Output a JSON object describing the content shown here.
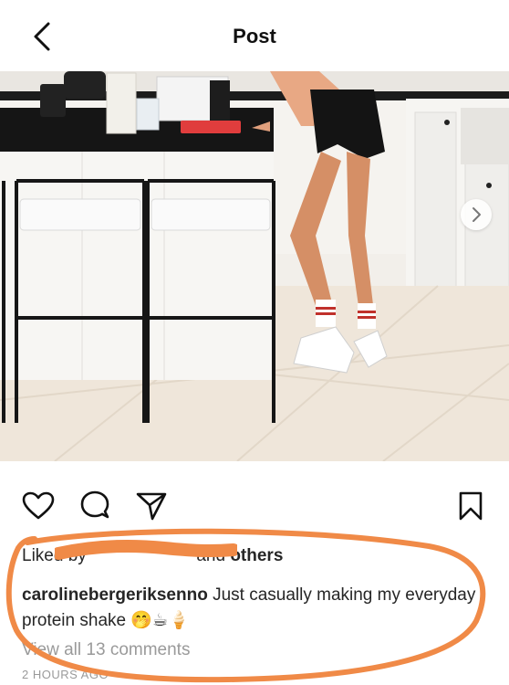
{
  "header": {
    "back_icon": "chevron-left-icon",
    "title": "Post"
  },
  "photo": {
    "description_icon": "kitchen-photo",
    "carousel": {
      "current": 1,
      "total": 2
    },
    "next_icon": "chevron-right-icon"
  },
  "actions": {
    "like_icon": "heart-outline-icon",
    "comment_icon": "comment-bubble-icon",
    "share_icon": "paper-plane-icon",
    "save_icon": "bookmark-outline-icon"
  },
  "likes": {
    "prefix": "Liked by",
    "and": "and",
    "others": "others"
  },
  "caption": {
    "username": "carolinebergeriksenno",
    "text": "Just casually making my everyday protein shake",
    "emojis": "🤭☕🍦"
  },
  "comments": {
    "view_all": "View all 13 comments"
  },
  "timestamp": "2 HOURS AGO",
  "annotation": {
    "color": "#f08a47"
  }
}
